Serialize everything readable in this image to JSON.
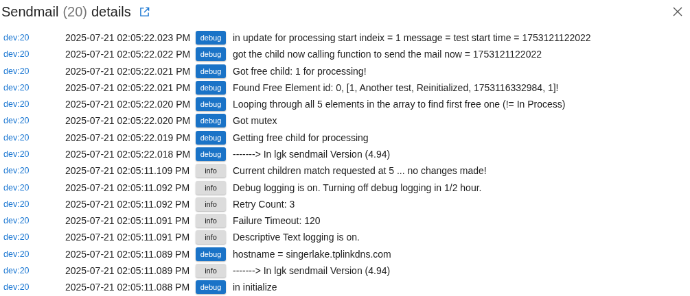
{
  "header": {
    "title": "Sendmail",
    "count": "(20)",
    "suffix": "details"
  },
  "rows": [
    {
      "device": "dev:20",
      "time": "2025-07-21 02:05:22.023 PM",
      "kind": "debug",
      "badge": "debug",
      "message": "in update for processing start indeix = 1 message = test start time = 1753121122022"
    },
    {
      "device": "dev:20",
      "time": "2025-07-21 02:05:22.022 PM",
      "kind": "debug",
      "badge": "debug",
      "message": "got the child now calling function to send the mail now = 1753121122022"
    },
    {
      "device": "dev:20",
      "time": "2025-07-21 02:05:22.021 PM",
      "kind": "debug",
      "badge": "debug",
      "message": "Got free child: 1 for processing!"
    },
    {
      "device": "dev:20",
      "time": "2025-07-21 02:05:22.021 PM",
      "kind": "debug",
      "badge": "debug",
      "message": "Found Free Element id: 0, [1, Another test, Reinitialized, 1753116332984, 1]!"
    },
    {
      "device": "dev:20",
      "time": "2025-07-21 02:05:22.020 PM",
      "kind": "debug",
      "badge": "debug",
      "message": "Looping through all 5 elements in the array to find first free one (!= In Process)"
    },
    {
      "device": "dev:20",
      "time": "2025-07-21 02:05:22.020 PM",
      "kind": "debug",
      "badge": "debug",
      "message": "Got mutex"
    },
    {
      "device": "dev:20",
      "time": "2025-07-21 02:05:22.019 PM",
      "kind": "debug",
      "badge": "debug",
      "message": "Getting free child for processing"
    },
    {
      "device": "dev:20",
      "time": "2025-07-21 02:05:22.018 PM",
      "kind": "debug",
      "badge": "debug",
      "message": "-------> In lgk sendmail Version (4.94)"
    },
    {
      "device": "dev:20",
      "time": "2025-07-21 02:05:11.109 PM",
      "kind": "info",
      "badge": "info",
      "message": "Current children match requested at 5 ... no changes made!"
    },
    {
      "device": "dev:20",
      "time": "2025-07-21 02:05:11.092 PM",
      "kind": "info",
      "badge": "info",
      "message": "Debug logging is on. Turning off debug logging in 1/2 hour."
    },
    {
      "device": "dev:20",
      "time": "2025-07-21 02:05:11.092 PM",
      "kind": "info",
      "badge": "info",
      "message": "Retry Count: 3"
    },
    {
      "device": "dev:20",
      "time": "2025-07-21 02:05:11.091 PM",
      "kind": "info",
      "badge": "info",
      "message": "Failure Timeout: 120"
    },
    {
      "device": "dev:20",
      "time": "2025-07-21 02:05:11.091 PM",
      "kind": "info",
      "badge": "info",
      "message": "Descriptive Text logging is on."
    },
    {
      "device": "dev:20",
      "time": "2025-07-21 02:05:11.089 PM",
      "kind": "debug",
      "badge": "debug",
      "message": "hostname = singerlake.tplinkdns.com"
    },
    {
      "device": "dev:20",
      "time": "2025-07-21 02:05:11.089 PM",
      "kind": "info",
      "badge": "info",
      "message": "-------> In lgk sendmail Version (4.94)"
    },
    {
      "device": "dev:20",
      "time": "2025-07-21 02:05:11.088 PM",
      "kind": "debug",
      "badge": "debug",
      "message": "in initialize"
    }
  ]
}
